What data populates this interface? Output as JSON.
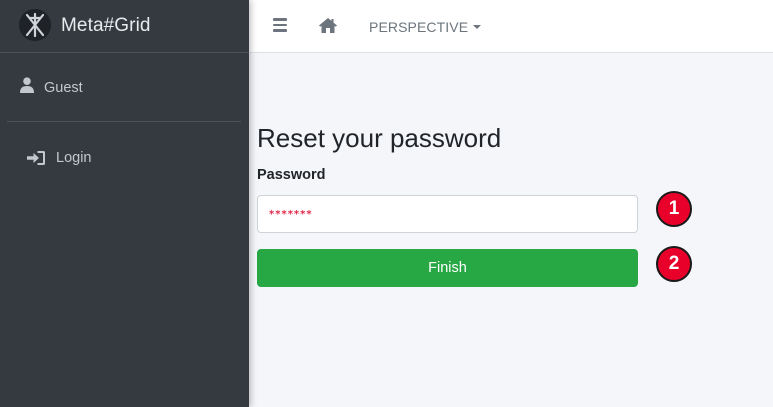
{
  "brand": {
    "name": "Meta#Grid",
    "logo_icon": "metagrid-logo-icon"
  },
  "sidebar": {
    "user": {
      "name": "Guest",
      "icon": "user-icon"
    },
    "items": [
      {
        "label": "Login",
        "icon": "sign-in-icon"
      }
    ]
  },
  "navbar": {
    "menu_icon": "hamburger-icon",
    "home_icon": "home-icon",
    "perspective_label": "PERSPECTIVE"
  },
  "form": {
    "title": "Reset your password",
    "password_label": "Password",
    "password_value": "*******",
    "submit_label": "Finish"
  },
  "annotations": {
    "marker_1": "1",
    "marker_2": "2"
  },
  "colors": {
    "sidebar_bg": "#343a40",
    "content_bg": "#f4f6f9",
    "button_green": "#28a745",
    "marker_red": "#e8002a",
    "password_text": "#e0284a"
  }
}
